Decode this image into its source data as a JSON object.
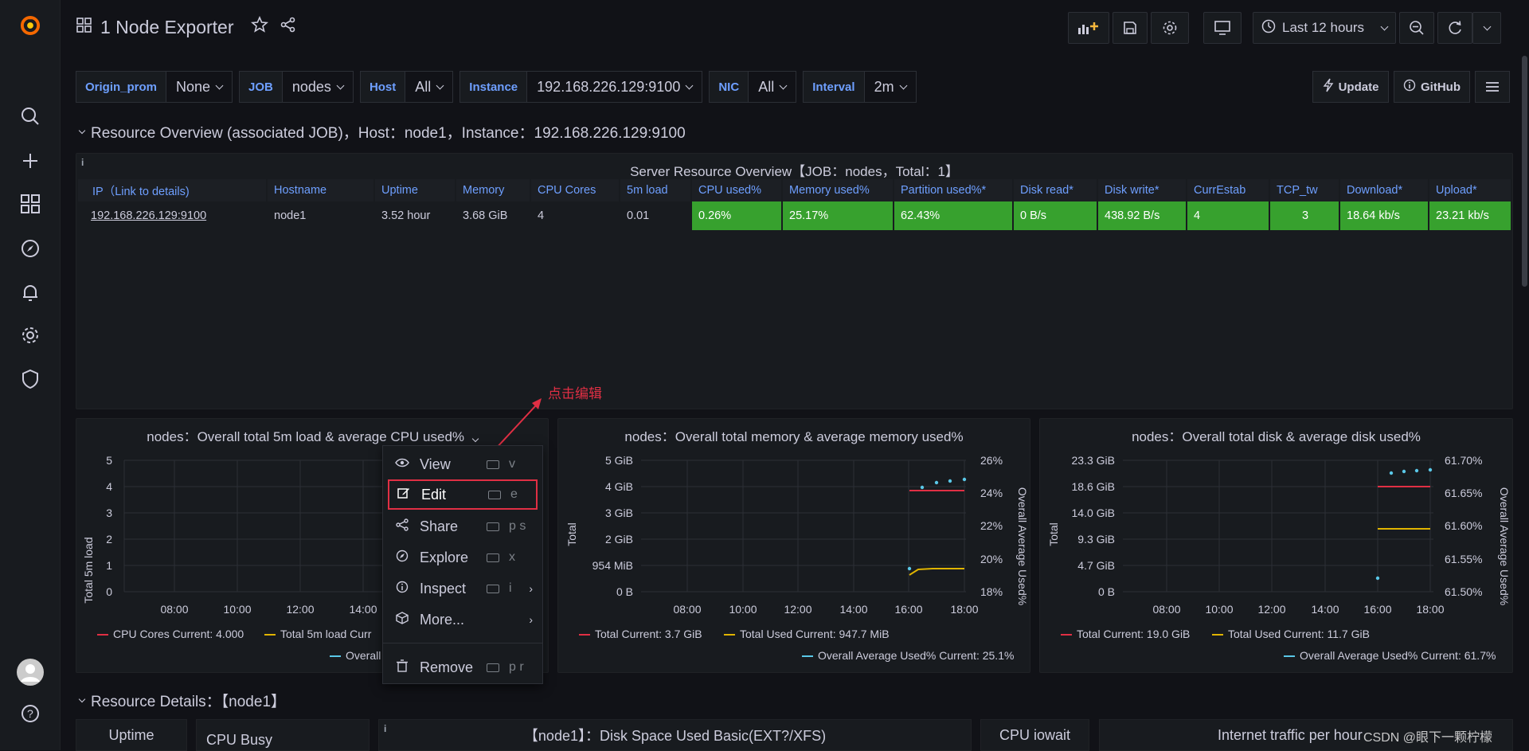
{
  "dashboard": {
    "title": "1 Node Exporter"
  },
  "toolbar": {
    "time_range": "Last 12 hours"
  },
  "variables": [
    {
      "label": "Origin_prom",
      "value": "None"
    },
    {
      "label": "JOB",
      "value": "nodes"
    },
    {
      "label": "Host",
      "value": "All"
    },
    {
      "label": "Instance",
      "value": "192.168.226.129:9100"
    },
    {
      "label": "NIC",
      "value": "All"
    },
    {
      "label": "Interval",
      "value": "2m"
    }
  ],
  "links": {
    "update": "Update",
    "github": "GitHub"
  },
  "rows": {
    "overview": "Resource Overview (associated JOB)，Host：node1，Instance：192.168.226.129:9100",
    "details": "Resource Details：【node1】"
  },
  "overview_table": {
    "title": "Server Resource Overview【JOB：nodes，Total：1】",
    "headers": [
      "IP（Link to details)",
      "Hostname",
      "Uptime",
      "Memory",
      "CPU Cores",
      "5m load",
      "CPU used%",
      "Memory used%",
      "Partition used%*",
      "Disk read*",
      "Disk write*",
      "CurrEstab",
      "TCP_tw",
      "Download*",
      "Upload*"
    ],
    "row": [
      "192.168.226.129:9100",
      "node1",
      "3.52 hour",
      "3.68 GiB",
      "4",
      "0.01",
      "0.26%",
      "25.17%",
      "62.43%",
      "0 B/s",
      "438.92 B/s",
      "4",
      "3",
      "18.64 kb/s",
      "23.21 kb/s"
    ]
  },
  "panels": {
    "load": {
      "title": "nodes：Overall total 5m load & average CPU used%",
      "ylabel": "Total 5m load",
      "yticks": [
        "5",
        "4",
        "3",
        "2",
        "1",
        "0"
      ],
      "xticks": [
        "08:00",
        "10:00",
        "12:00",
        "14:00"
      ],
      "legend1": "CPU Cores  Current: 4.000",
      "legend2": "Total 5m load  Curr",
      "legend3": "Overall"
    },
    "memory": {
      "title": "nodes：Overall total memory & average memory used%",
      "ylabel": "Total",
      "ylabel2": "Overall Average Used%",
      "yticks": [
        "5 GiB",
        "4 GiB",
        "3 GiB",
        "2 GiB",
        "954 MiB",
        "0 B"
      ],
      "yticks2": [
        "26%",
        "24%",
        "22%",
        "20%",
        "18%"
      ],
      "xticks": [
        "08:00",
        "10:00",
        "12:00",
        "14:00",
        "16:00",
        "18:00"
      ],
      "legend1": "Total  Current: 3.7 GiB",
      "legend2": "Total Used  Current: 947.7 MiB",
      "legend3": "Overall Average Used%  Current: 25.1%"
    },
    "disk": {
      "title": "nodes：Overall total disk & average disk used%",
      "ylabel": "Total",
      "ylabel2": "Overall Average Used%",
      "yticks": [
        "23.3 GiB",
        "18.6 GiB",
        "14.0 GiB",
        "9.3 GiB",
        "4.7 GiB",
        "0 B"
      ],
      "yticks2": [
        "61.70%",
        "61.65%",
        "61.60%",
        "61.55%",
        "61.50%"
      ],
      "xticks": [
        "08:00",
        "10:00",
        "12:00",
        "14:00",
        "16:00",
        "18:00"
      ],
      "legend1": "Total  Current: 19.0 GiB",
      "legend2": "Total Used  Current: 11.7 GiB",
      "legend3": "Overall Average Used%  Current: 61.7%"
    }
  },
  "context_menu": [
    {
      "label": "View",
      "shortcut": "v"
    },
    {
      "label": "Edit",
      "shortcut": "e"
    },
    {
      "label": "Share",
      "shortcut": "p s"
    },
    {
      "label": "Explore",
      "shortcut": "x"
    },
    {
      "label": "Inspect",
      "shortcut": "i"
    },
    {
      "label": "More...",
      "shortcut": ""
    },
    {
      "label": "Remove",
      "shortcut": "p r"
    }
  ],
  "annotation": "点击编辑",
  "bottom_panels": {
    "uptime": "Uptime",
    "cpu_busy": "CPU Busy",
    "disk_space": "【node1】：Disk Space Used Basic(EXT?/XFS)",
    "cpu_iowait": "CPU iowait",
    "traffic": "Internet traffic per hour",
    "watermark": "CSDN @眼下一颗柠檬"
  },
  "colors": {
    "accent": "#6e9fff",
    "green": "#37a12e",
    "red": "#e02f44",
    "yellow": "#e0b400",
    "cyan": "#5ac8e8"
  }
}
